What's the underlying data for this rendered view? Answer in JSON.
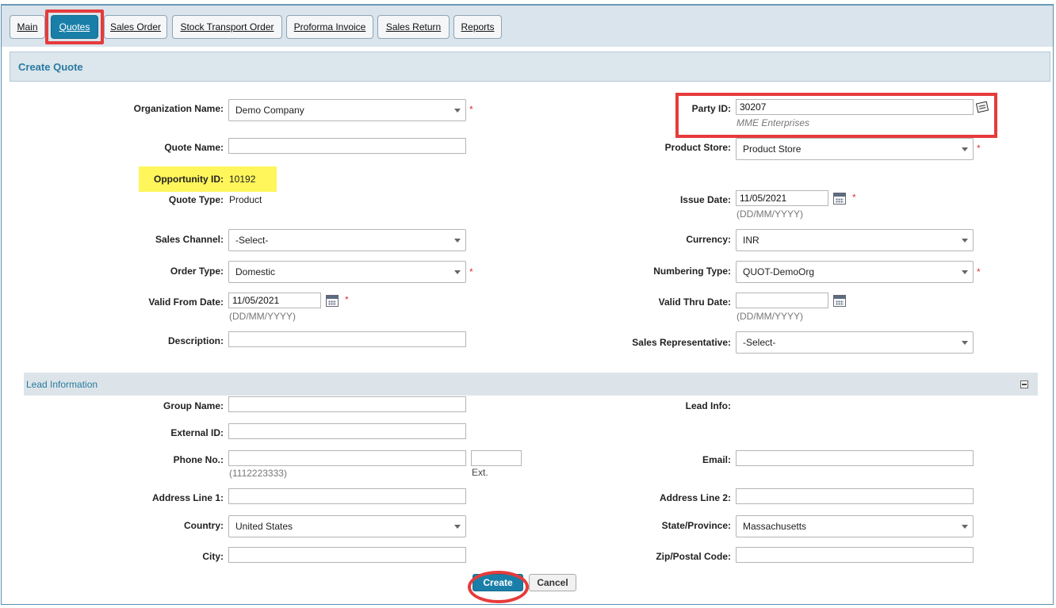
{
  "tabs": [
    {
      "label": "Main",
      "active": false
    },
    {
      "label": "Quotes",
      "active": true
    },
    {
      "label": "Sales Order",
      "active": false
    },
    {
      "label": "Stock Transport Order",
      "active": false
    },
    {
      "label": "Proforma Invoice",
      "active": false
    },
    {
      "label": "Sales Return",
      "active": false
    },
    {
      "label": "Reports",
      "active": false
    }
  ],
  "section_title": "Create Quote",
  "form": {
    "organization_name": {
      "label": "Organization Name:",
      "value": "Demo Company"
    },
    "quote_name": {
      "label": "Quote Name:",
      "value": ""
    },
    "opportunity_id": {
      "label": "Opportunity ID:",
      "value": "10192"
    },
    "quote_type": {
      "label": "Quote Type:",
      "value": "Product"
    },
    "sales_channel": {
      "label": "Sales Channel:",
      "value": "-Select-"
    },
    "order_type": {
      "label": "Order Type:",
      "value": "Domestic"
    },
    "valid_from_date": {
      "label": "Valid From Date:",
      "value": "11/05/2021",
      "hint": "(DD/MM/YYYY)"
    },
    "description": {
      "label": "Description:",
      "value": ""
    },
    "party_id": {
      "label": "Party ID:",
      "value": "30207",
      "party_name": "MME Enterprises"
    },
    "product_store": {
      "label": "Product Store:",
      "value": "Product Store"
    },
    "issue_date": {
      "label": "Issue Date:",
      "value": "11/05/2021",
      "hint": "(DD/MM/YYYY)"
    },
    "currency": {
      "label": "Currency:",
      "value": "INR"
    },
    "numbering_type": {
      "label": "Numbering Type:",
      "value": "QUOT-DemoOrg"
    },
    "valid_thru_date": {
      "label": "Valid Thru Date:",
      "value": "",
      "hint": "(DD/MM/YYYY)"
    },
    "sales_representative": {
      "label": "Sales Representative:",
      "value": "-Select-"
    },
    "required_mark": "*"
  },
  "lead": {
    "title": "Lead Information",
    "group_name": {
      "label": "Group Name:",
      "value": ""
    },
    "external_id": {
      "label": "External ID:",
      "value": ""
    },
    "phone_no": {
      "label": "Phone No.:",
      "value": "",
      "hint": "(1112223333)",
      "ext_label": "Ext."
    },
    "address_line_1": {
      "label": "Address Line 1:",
      "value": ""
    },
    "country": {
      "label": "Country:",
      "value": "United States"
    },
    "city": {
      "label": "City:",
      "value": ""
    },
    "lead_info": {
      "label": "Lead Info:"
    },
    "email": {
      "label": "Email:",
      "value": ""
    },
    "address_line_2": {
      "label": "Address Line 2:",
      "value": ""
    },
    "state_province": {
      "label": "State/Province:",
      "value": "Massachusetts"
    },
    "zip_postal_code": {
      "label": "Zip/Postal Code:",
      "value": ""
    }
  },
  "actions": {
    "create": "Create",
    "cancel": "Cancel"
  },
  "colors": {
    "accent": "#1a7fa8",
    "highlight_red": "#e63b3b",
    "highlight_yellow": "#fef65b"
  }
}
